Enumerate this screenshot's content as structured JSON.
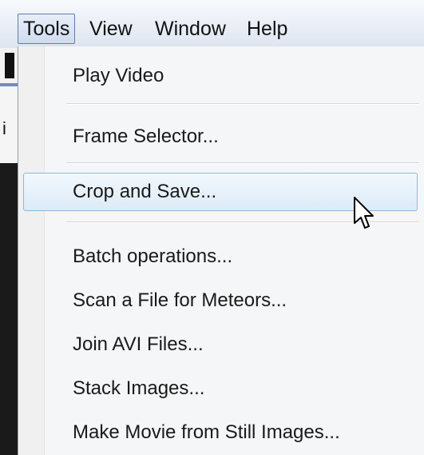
{
  "menubar": {
    "items": [
      "Tools",
      "View",
      "Window",
      "Help"
    ],
    "active_index": 0
  },
  "left_strip": {
    "fragment": "i"
  },
  "tools_menu": {
    "items": [
      {
        "label": "Play Video"
      },
      {
        "label": "Frame Selector..."
      },
      {
        "label": "Crop and Save...",
        "highlighted": true
      },
      {
        "label": "Batch operations..."
      },
      {
        "label": "Scan a File for Meteors..."
      },
      {
        "label": "Join AVI Files..."
      },
      {
        "label": "Stack Images..."
      },
      {
        "label": "Make Movie from Still Images..."
      }
    ]
  },
  "cursor": {
    "icon": "mouse-pointer-icon"
  },
  "colors": {
    "highlight_border": "#8fb8de",
    "menubar_active_border": "#5f7ea8",
    "menu_background": "#f5f6f7"
  }
}
